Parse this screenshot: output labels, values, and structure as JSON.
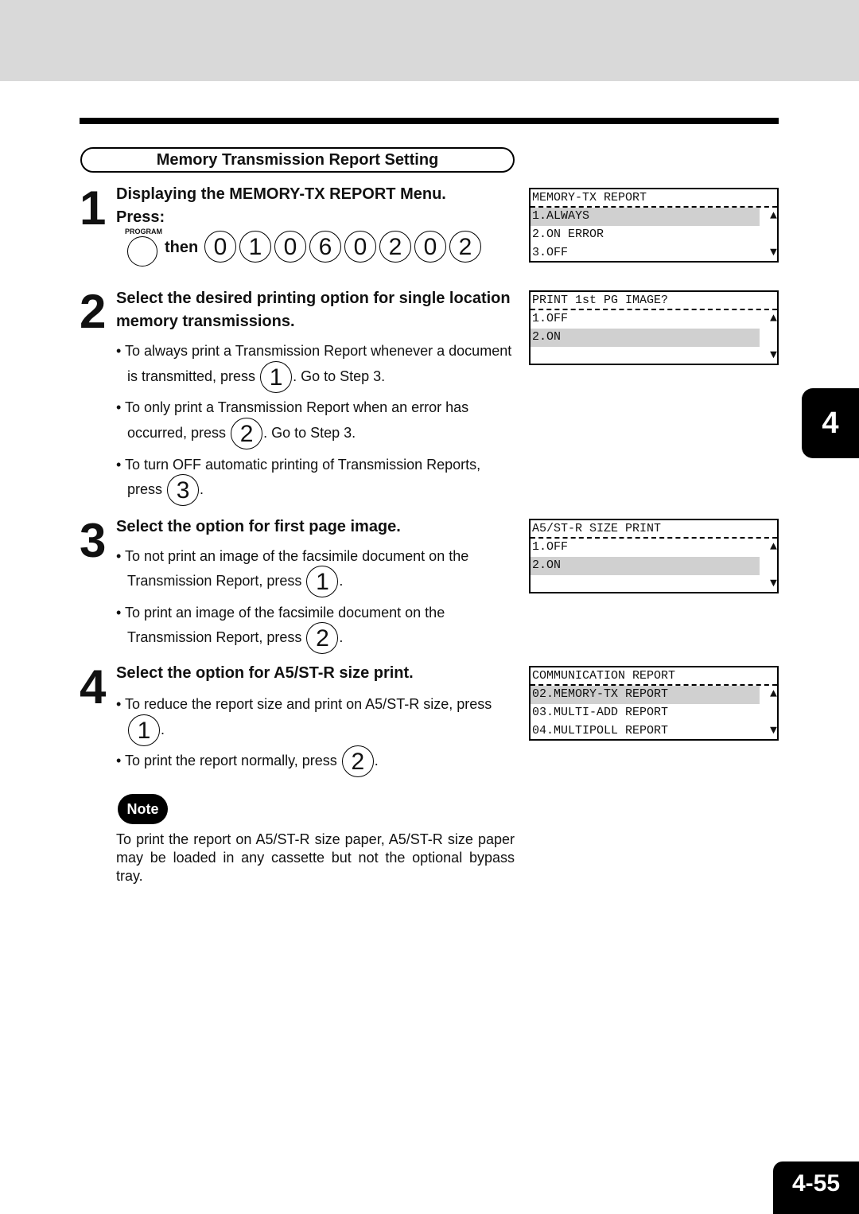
{
  "section_title": "Memory Transmission Report Setting",
  "chapter_tab": "4",
  "page_number": "4-55",
  "step1": {
    "num": "1",
    "title": "Displaying the MEMORY-TX REPORT Menu.",
    "press": "Press:",
    "program_label": "PROGRAM",
    "then": "then",
    "keys": [
      "0",
      "1",
      "0",
      "6",
      "0",
      "2",
      "0",
      "2"
    ]
  },
  "step2": {
    "num": "2",
    "title_line1": "Select the desired printing option for single location",
    "title_line2": "memory transmissions.",
    "b1a": "To always print a Transmission Report whenever a document",
    "b1b": "is transmitted, press",
    "b1key": "1",
    "b1c": ".  Go to Step 3.",
    "b2a": "To only print a Transmission Report when an error has",
    "b2b": "occurred, press",
    "b2key": "2",
    "b2c": ".  Go to Step 3.",
    "b3a": "To turn OFF automatic printing of Transmission Reports,",
    "b3b": "press",
    "b3key": "3",
    "b3c": "."
  },
  "step3": {
    "num": "3",
    "title": "Select the option for first page image.",
    "b1a": "To not print an image of the facsimile document on the",
    "b1b": "Transmission Report, press",
    "b1key": "1",
    "b1c": ".",
    "b2a": "To print an image of the facsimile document on the",
    "b2b": "Transmission Report, press",
    "b2key": "2",
    "b2c": "."
  },
  "step4": {
    "num": "4",
    "title": "Select the option for A5/ST-R size print.",
    "b1a": "To reduce the report size and print on A5/ST-R size, press",
    "b1key": "1",
    "b1c": ".",
    "b2a": "To print the report normally, press",
    "b2key": "2",
    "b2c": "."
  },
  "note": {
    "label": "Note",
    "text": "To print the report on A5/ST-R size paper, A5/ST-R size paper may be loaded in any cassette but not the optional bypass tray."
  },
  "lcds": [
    {
      "rows": [
        "MEMORY-TX REPORT",
        "1.ALWAYS",
        "2.ON ERROR",
        "3.OFF"
      ],
      "highlight": 1
    },
    {
      "rows": [
        "PRINT 1st PG IMAGE?",
        "1.OFF",
        "2.ON",
        ""
      ],
      "highlight": 2
    },
    {
      "rows": [
        "A5/ST-R SIZE PRINT",
        "1.OFF",
        "2.ON",
        ""
      ],
      "highlight": 2
    },
    {
      "rows": [
        "COMMUNICATION REPORT",
        "02.MEMORY-TX REPORT",
        "03.MULTI-ADD REPORT",
        "04.MULTIPOLL REPORT"
      ],
      "highlight": 1
    }
  ],
  "arrows": {
    "up": "▲",
    "down": "▼"
  }
}
